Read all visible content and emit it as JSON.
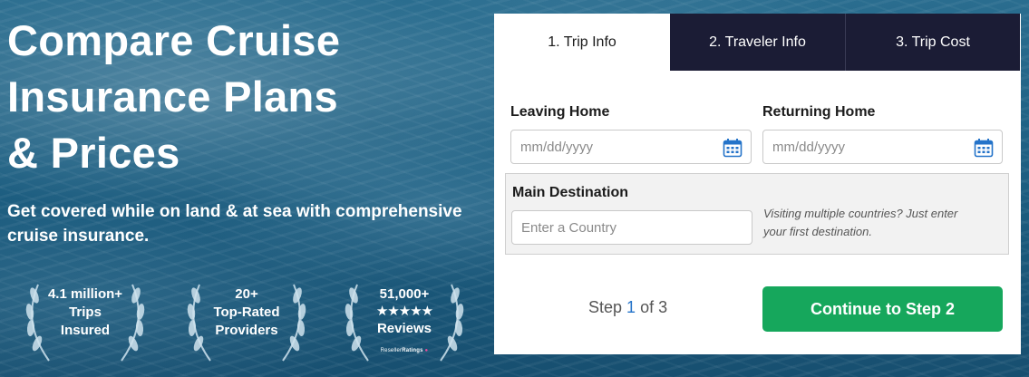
{
  "hero": {
    "headline_lines": [
      "Compare Cruise",
      "Insurance Plans",
      "& Prices"
    ],
    "subhead_lines": [
      "Get covered while on land & at sea with comprehensive",
      "cruise insurance."
    ]
  },
  "badges": [
    {
      "lines": [
        "4.1 million+",
        "Trips",
        "Insured"
      ]
    },
    {
      "lines": [
        "20+",
        "Top-Rated",
        "Providers"
      ]
    },
    {
      "lines": [
        "51,000+"
      ],
      "stars": "★★★★★",
      "bottom": "Reviews",
      "source_prefix": "Reseller",
      "source_bold": "Ratings"
    }
  ],
  "tabs": [
    {
      "label": "1. Trip Info",
      "active": true
    },
    {
      "label": "2. Traveler Info",
      "active": false
    },
    {
      "label": "3. Trip Cost",
      "active": false
    }
  ],
  "form": {
    "leaving_label": "Leaving Home",
    "leaving_placeholder": "mm/dd/yyyy",
    "returning_label": "Returning Home",
    "returning_placeholder": "mm/dd/yyyy",
    "destination_label": "Main Destination",
    "destination_placeholder": "Enter a Country",
    "destination_hint_lines": [
      "Visiting multiple countries? Just enter",
      "your first destination."
    ]
  },
  "footer": {
    "step_prefix": "Step",
    "step_current": "1",
    "step_suffix": "of 3",
    "continue_label": "Continue to Step 2"
  },
  "colors": {
    "tab_dark": "#1b1c35",
    "continue_green": "#16a75c",
    "step_blue": "#2473c9",
    "calendar_blue": "#2473c9"
  },
  "icons": {
    "calendar": "calendar-icon",
    "laurel": "laurel-wreath-icon",
    "star": "star-icon"
  }
}
